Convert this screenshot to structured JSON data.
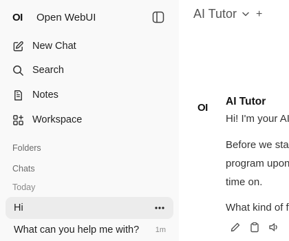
{
  "app": {
    "logo_text": "OI",
    "name": "Open WebUI"
  },
  "nav": {
    "new_chat": "New Chat",
    "search": "Search",
    "notes": "Notes",
    "workspace": "Workspace"
  },
  "sections": {
    "folders": "Folders",
    "chats": "Chats",
    "today": "Today"
  },
  "chats": [
    {
      "title": "Hi",
      "active": true
    },
    {
      "title": "What can you help me with?",
      "age": "1m"
    }
  ],
  "header": {
    "model_name": "AI Tutor",
    "add_label": "+"
  },
  "message": {
    "avatar_text": "OI",
    "sender": "AI Tutor",
    "line1": "Hi! I'm your AI",
    "line2": "Before we start",
    "line3": "program upon yo",
    "line4": "time on.",
    "line5": "What kind of fi"
  },
  "icons": {
    "sidebar_toggle": "sidebar-toggle-icon",
    "new_chat": "edit-icon",
    "search": "search-icon",
    "notes": "notes-icon",
    "workspace": "workspace-icon",
    "more": "ellipsis-icon",
    "edit": "pencil-icon",
    "copy": "clipboard-icon",
    "speak": "speaker-icon"
  }
}
